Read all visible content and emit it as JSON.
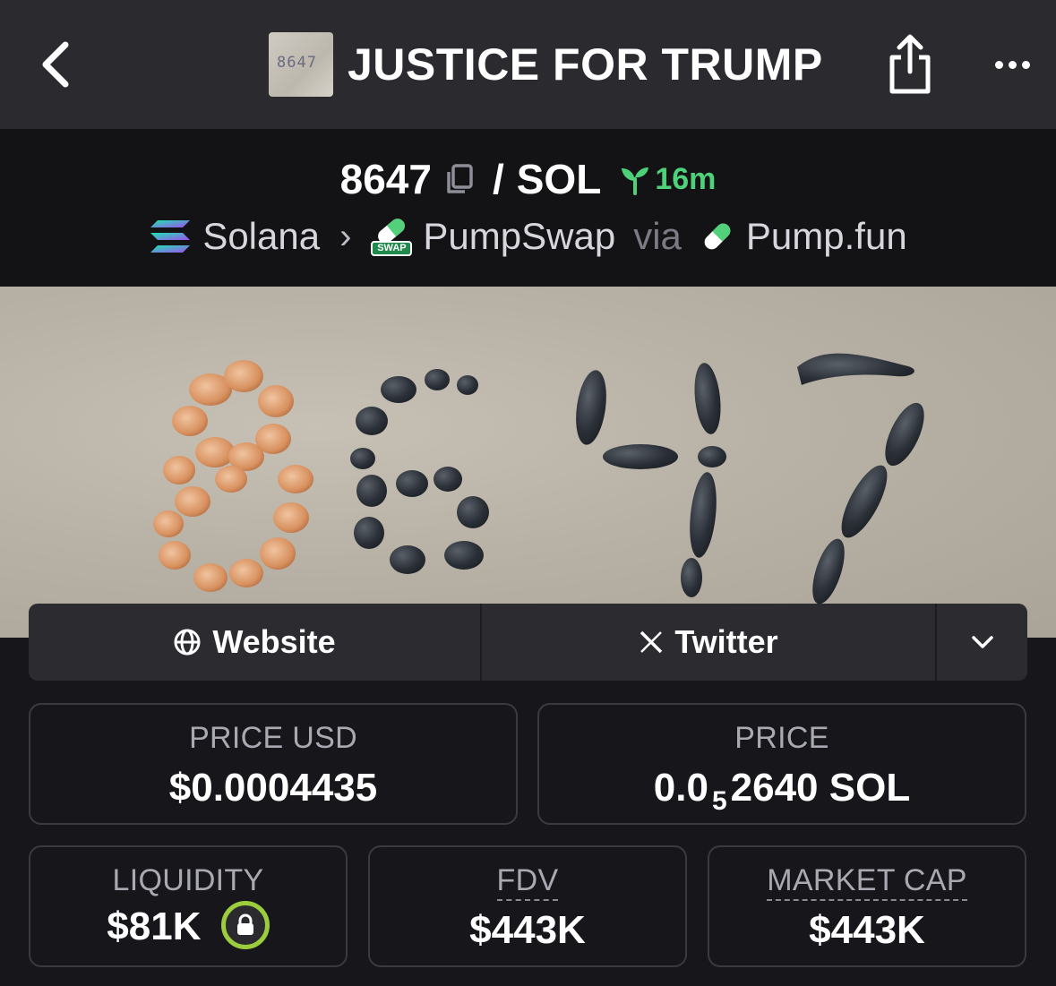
{
  "header": {
    "title": "JUSTICE FOR TRUMP",
    "thumb_text": "8647"
  },
  "pair": {
    "base": "8647",
    "separator": "/",
    "quote": "SOL",
    "age": "16m",
    "chain": "Solana",
    "dex": "PumpSwap",
    "via": "via",
    "launchpad": "Pump.fun",
    "dex_badge": "SWAP"
  },
  "links": {
    "website": "Website",
    "twitter": "Twitter"
  },
  "stats": {
    "price_usd_label": "PRICE USD",
    "price_usd_value": "$0.0004435",
    "price_label": "PRICE",
    "price_prefix": "0.0",
    "price_sub": "5",
    "price_digits": "2640",
    "price_unit": "SOL",
    "liquidity_label": "LIQUIDITY",
    "liquidity_value": "$81K",
    "fdv_label": "FDV",
    "fdv_value": "$443K",
    "mcap_label": "MARKET CAP",
    "mcap_value": "$443K"
  },
  "colors": {
    "header_bg": "#2a2a2f",
    "pair_bg": "#131316",
    "page_bg": "#17171b",
    "age_green": "#4fd17a",
    "lock_ring": "#9ccd3c"
  },
  "icons": [
    "back-icon",
    "share-icon",
    "more-icon",
    "copy-icon",
    "seedling-icon",
    "solana-icon",
    "chevron-right-icon",
    "pumpswap-icon",
    "pill-icon",
    "globe-icon",
    "x-icon",
    "chevron-down-icon",
    "lock-icon"
  ]
}
